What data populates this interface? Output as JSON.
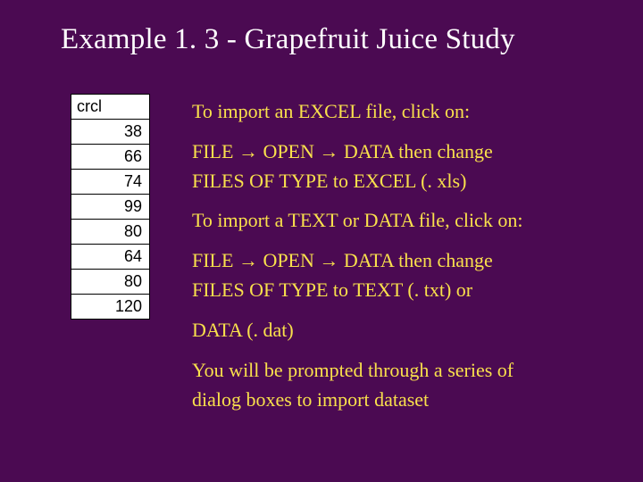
{
  "title": "Example 1. 3 - Grapefruit Juice Study",
  "table": {
    "header": "crcl",
    "rows": [
      "38",
      "66",
      "74",
      "99",
      "80",
      "64",
      "80",
      "120"
    ]
  },
  "body": {
    "p1": "To import an EXCEL file, click on:",
    "p2a": "FILE → OPEN → DATA then change",
    "p2b": "FILES OF TYPE to EXCEL (. xls)",
    "p3": "To import a TEXT or DATA file, click on:",
    "p4a": " FILE → OPEN → DATA then change",
    "p4b": "FILES OF TYPE to TEXT (. txt) or",
    "p5": "DATA (. dat)",
    "p6a": "You will be prompted through a series of",
    "p6b": "dialog boxes to import dataset"
  }
}
